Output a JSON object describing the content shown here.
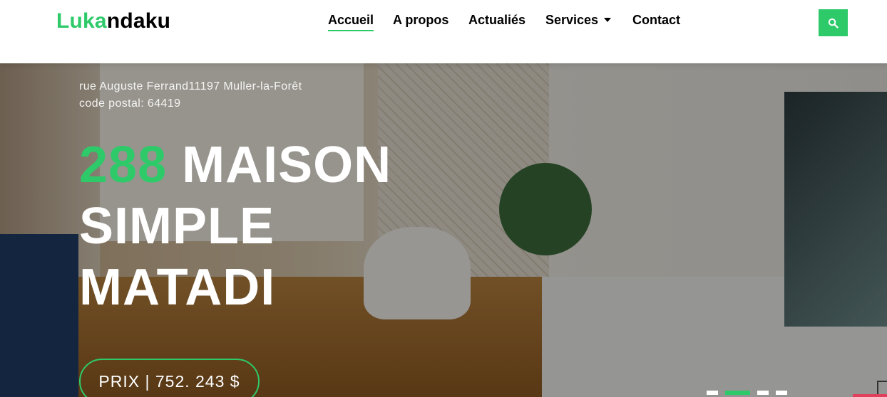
{
  "brand": {
    "part1": "Luka",
    "part2": "ndaku"
  },
  "nav": {
    "items": [
      {
        "label": "Accueil",
        "active": true
      },
      {
        "label": "A propos",
        "active": false
      },
      {
        "label": "Actualiés",
        "active": false
      },
      {
        "label": "Services",
        "active": false,
        "dropdown": true
      },
      {
        "label": "Contact",
        "active": false
      }
    ],
    "search_icon": "search-icon"
  },
  "hero": {
    "address_line1": "rue Auguste Ferrand11197 Muller-la-Forêt",
    "address_line2": "code postal: 64419",
    "title_number": "288",
    "title_text": " MAISON SIMPLE MATADI",
    "price_label": "PRIX | 752. 243 $"
  },
  "carousel": {
    "slides": 4,
    "active_index": 1
  },
  "colors": {
    "accent": "#2eca6a",
    "text": "#000000",
    "indicator_red": "#e0405c"
  }
}
